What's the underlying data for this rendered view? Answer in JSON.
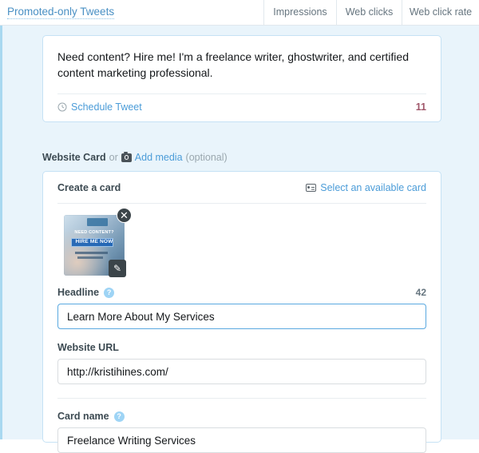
{
  "header": {
    "promoted_link": "Promoted-only Tweets",
    "metrics": [
      {
        "label": "Impressions"
      },
      {
        "label": "Web clicks"
      },
      {
        "label": "Web click rate"
      }
    ]
  },
  "compose": {
    "tweet_text": "Need content? Hire me! I'm a freelance writer, ghostwriter, and certified content marketing professional.",
    "schedule_label": "Schedule Tweet",
    "schedule_icon": "clock-icon",
    "char_count": "11"
  },
  "media_row": {
    "title": "Website Card",
    "or": "or",
    "add_media_icon": "camera-icon",
    "add_media": "Add media",
    "optional": "(optional)"
  },
  "card": {
    "heading": "Create a card",
    "select_card_icon": "card-stack-icon",
    "select_card": "Select an available card",
    "thumbnail": {
      "overlay_line_1": "NEED CONTENT?",
      "overlay_line_2": "HIRE ME NOW",
      "remove_glyph": "✕",
      "edit_glyph": "✎"
    },
    "fields": [
      {
        "label": "Headline",
        "has_help": true,
        "help_glyph": "?",
        "count": "42",
        "value": "Learn More About My Services",
        "focused": true
      },
      {
        "label": "Website URL",
        "has_help": false,
        "count": "",
        "value": "http://kristihines.com/",
        "focused": false
      },
      {
        "label": "Card name",
        "has_help": true,
        "help_glyph": "?",
        "count": "",
        "value": "Freelance Writing Services",
        "focused": false
      }
    ]
  },
  "colors": {
    "page_bg": "#e9f4fb",
    "link_blue": "#4b9cd8",
    "panel_border": "#c6e2f5",
    "focus_border": "#5aa9e0",
    "count_maroon": "#a0576a",
    "help_icon": "#9ed4f5"
  }
}
